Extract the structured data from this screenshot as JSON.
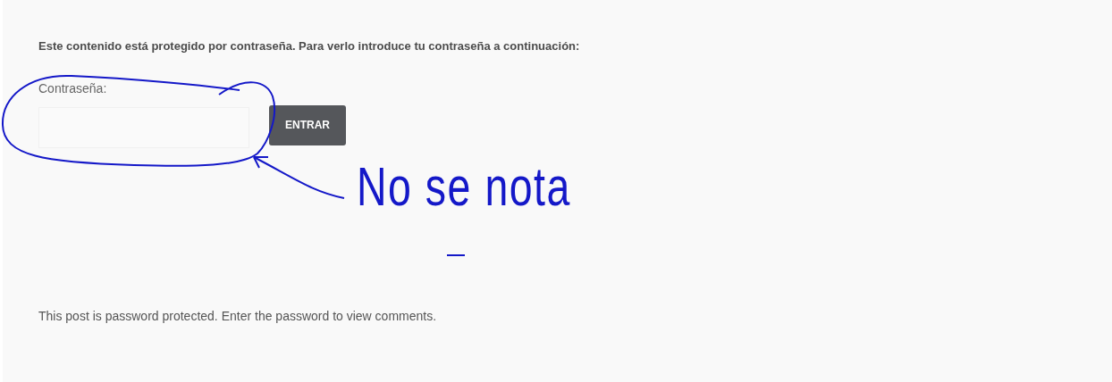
{
  "notice": "Este contenido está protegido por contraseña. Para verlo introduce tu contraseña a continuación:",
  "password_field": {
    "label": "Contraseña:"
  },
  "submit_button": {
    "label": "ENTRAR"
  },
  "comments_notice": "This post is password protected. Enter the password to view comments.",
  "annotation": {
    "text": "No se nota"
  }
}
